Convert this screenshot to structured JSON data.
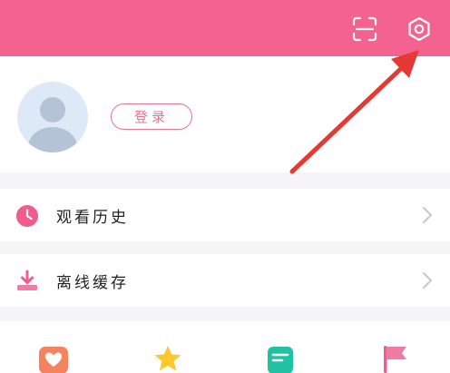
{
  "header": {
    "scan_icon": "scan-icon",
    "settings_icon": "gear-icon",
    "background": "#f4628f"
  },
  "profile": {
    "avatar_icon": "default-avatar",
    "login_label": "登录"
  },
  "menu": [
    {
      "icon": "clock-icon",
      "label": "观看历史"
    },
    {
      "icon": "download-icon",
      "label": "离线缓存"
    }
  ],
  "bottom_icons": [
    "heart-icon",
    "star-icon",
    "note-icon",
    "flag-icon"
  ],
  "annotation": {
    "color": "#e53935"
  }
}
